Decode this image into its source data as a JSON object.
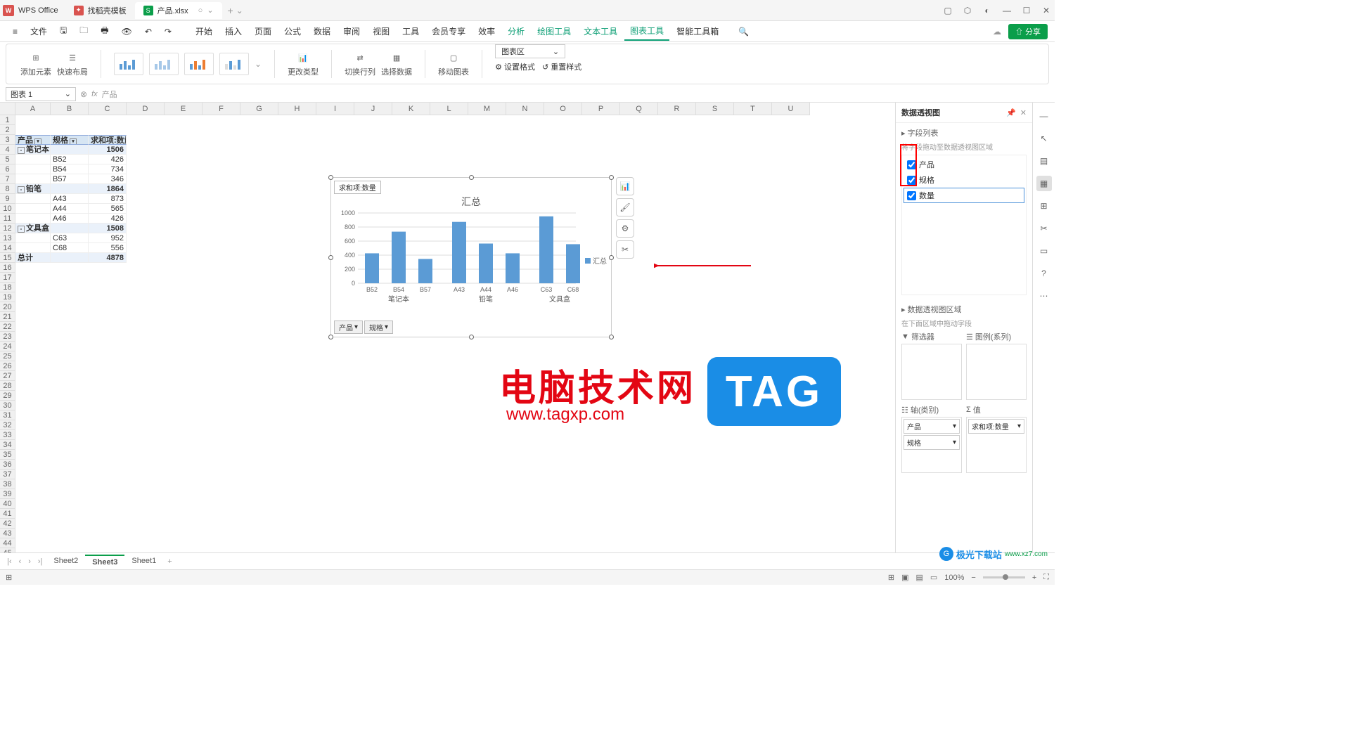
{
  "app": {
    "name": "WPS Office"
  },
  "tabs": [
    {
      "label": "找稻壳模板",
      "icon": "red"
    },
    {
      "label": "产品.xlsx",
      "icon": "green",
      "active": true
    }
  ],
  "menu": {
    "file": "文件",
    "items": [
      "开始",
      "插入",
      "页面",
      "公式",
      "数据",
      "审阅",
      "视图",
      "工具",
      "会员专享",
      "效率"
    ],
    "teal": [
      "分析",
      "绘图工具",
      "文本工具"
    ],
    "active": "图表工具",
    "smart": "智能工具箱"
  },
  "ribbon": {
    "addElement": "添加元素",
    "quickLayout": "快速布局",
    "changeType": "更改类型",
    "switchRowCol": "切换行列",
    "selectData": "选择数据",
    "moveChart": "移动图表",
    "chartAreaLabel": "图表区",
    "setFormat": "设置格式",
    "resetStyle": "重置样式"
  },
  "nameBox": "图表 1",
  "formula": "产品",
  "share": "分享",
  "columns": [
    "A",
    "B",
    "C",
    "D",
    "E",
    "F",
    "G",
    "H",
    "I",
    "J",
    "K",
    "L",
    "M",
    "N",
    "O",
    "P",
    "Q",
    "R",
    "S",
    "T",
    "U"
  ],
  "pivot": {
    "headers": [
      "产品",
      "规格",
      "求和项:数量"
    ],
    "rows": [
      {
        "a": "笔记本",
        "c": "1506",
        "group": true
      },
      {
        "b": "B52",
        "c": "426"
      },
      {
        "b": "B54",
        "c": "734"
      },
      {
        "b": "B57",
        "c": "346"
      },
      {
        "a": "铅笔",
        "c": "1864",
        "group": true
      },
      {
        "b": "A43",
        "c": "873"
      },
      {
        "b": "A44",
        "c": "565"
      },
      {
        "b": "A46",
        "c": "426"
      },
      {
        "a": "文具盒",
        "c": "1508",
        "group": true
      },
      {
        "b": "C63",
        "c": "952"
      },
      {
        "b": "C68",
        "c": "556"
      }
    ],
    "totalLabel": "总计",
    "totalValue": "4878"
  },
  "chart_data": {
    "type": "bar",
    "title": "汇总",
    "ytitle": "求和项:数量",
    "ylim": [
      0,
      1000
    ],
    "yticks": [
      0,
      200,
      400,
      600,
      800,
      1000
    ],
    "legend": "汇总",
    "groups": [
      {
        "name": "笔记本",
        "items": [
          {
            "x": "B52",
            "y": 426
          },
          {
            "x": "B54",
            "y": 734
          },
          {
            "x": "B57",
            "y": 346
          }
        ]
      },
      {
        "name": "铅笔",
        "items": [
          {
            "x": "A43",
            "y": 873
          },
          {
            "x": "A44",
            "y": 565
          },
          {
            "x": "A46",
            "y": 426
          }
        ]
      },
      {
        "name": "文具盒",
        "items": [
          {
            "x": "C63",
            "y": 952
          },
          {
            "x": "C68",
            "y": 556
          }
        ]
      }
    ],
    "filters": [
      "产品",
      "规格"
    ]
  },
  "sidePanel": {
    "title": "数据透视图",
    "fieldListTitle": "字段列表",
    "fieldListNote": "将字段拖动至数据透视图区域",
    "fields": [
      {
        "label": "产品",
        "checked": true
      },
      {
        "label": "规格",
        "checked": true
      },
      {
        "label": "数量",
        "checked": true,
        "selected": true
      }
    ],
    "areaTitle": "数据透视图区域",
    "areaNote": "在下面区域中拖动字段",
    "filterLabel": "筛选器",
    "legendLabel": "图例(系列)",
    "axisLabel": "轴(类别)",
    "valueLabel": "值",
    "axisItems": [
      "产品",
      "规格"
    ],
    "valueItems": [
      "求和项:数量"
    ]
  },
  "sheetTabs": [
    "Sheet2",
    "Sheet3",
    "Sheet1"
  ],
  "activeSheet": "Sheet3",
  "zoom": "100%",
  "watermark": {
    "cn": "电脑技术网",
    "url": "www.tagxp.com",
    "tag": "TAG",
    "site": "极光下载站",
    "siteurl": "www.xz7.com"
  }
}
